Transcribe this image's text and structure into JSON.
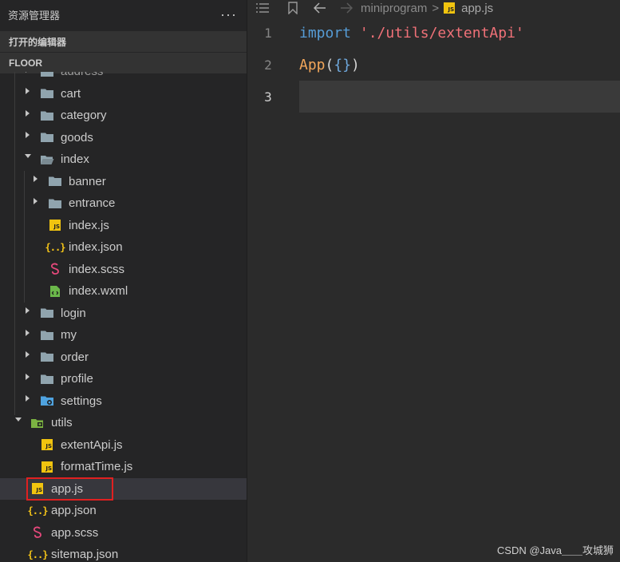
{
  "explorer": {
    "title": "资源管理器",
    "more_label": "···",
    "open_editors_label": "打开的编辑器",
    "root_label": "FLOOR"
  },
  "tree": [
    {
      "label": "address",
      "type": "folder",
      "state": "collapsed",
      "indent": 1,
      "partial": true
    },
    {
      "label": "cart",
      "type": "folder",
      "state": "collapsed",
      "indent": 1
    },
    {
      "label": "category",
      "type": "folder",
      "state": "collapsed",
      "indent": 1
    },
    {
      "label": "goods",
      "type": "folder",
      "state": "collapsed",
      "indent": 1
    },
    {
      "label": "index",
      "type": "folder",
      "state": "expanded",
      "indent": 1
    },
    {
      "label": "banner",
      "type": "folder",
      "state": "collapsed",
      "indent": 2
    },
    {
      "label": "entrance",
      "type": "folder",
      "state": "collapsed",
      "indent": 2
    },
    {
      "label": "index.js",
      "type": "js",
      "indent": 2
    },
    {
      "label": "index.json",
      "type": "json",
      "indent": 2
    },
    {
      "label": "index.scss",
      "type": "scss",
      "indent": 2
    },
    {
      "label": "index.wxml",
      "type": "wxml",
      "indent": 2
    },
    {
      "label": "login",
      "type": "folder",
      "state": "collapsed",
      "indent": 1
    },
    {
      "label": "my",
      "type": "folder",
      "state": "collapsed",
      "indent": 1
    },
    {
      "label": "order",
      "type": "folder",
      "state": "collapsed",
      "indent": 1
    },
    {
      "label": "profile",
      "type": "folder",
      "state": "collapsed",
      "indent": 1
    },
    {
      "label": "settings",
      "type": "settings-folder",
      "state": "collapsed",
      "indent": 1
    },
    {
      "label": "utils",
      "type": "utils-folder",
      "state": "expanded",
      "indent": 0
    },
    {
      "label": "extentApi.js",
      "type": "js",
      "indent": 1
    },
    {
      "label": "formatTime.js",
      "type": "js",
      "indent": 1
    },
    {
      "label": "app.js",
      "type": "js",
      "indent": 0,
      "selected": true
    },
    {
      "label": "app.json",
      "type": "json",
      "indent": 0
    },
    {
      "label": "app.scss",
      "type": "scss",
      "indent": 0
    },
    {
      "label": "sitemap.json",
      "type": "json",
      "indent": 0
    }
  ],
  "editor": {
    "breadcrumb_folder": "miniprogram",
    "breadcrumb_sep": ">",
    "breadcrumb_file": "app.js",
    "line_numbers": [
      "1",
      "2",
      "3"
    ],
    "line1": {
      "keyword": "import",
      "space": " ",
      "string": "'./utils/extentApi'"
    },
    "line2": {
      "fn": "App",
      "open": "(",
      "braces": "{}",
      "close": ")"
    }
  },
  "colors": {
    "keyword": "#569cd6",
    "string": "#f07178",
    "function": "#f2a65a",
    "selection_box": "#e02020",
    "js_icon": "#f1c40f"
  },
  "watermark": "CSDN @Java＿＿攻城狮"
}
